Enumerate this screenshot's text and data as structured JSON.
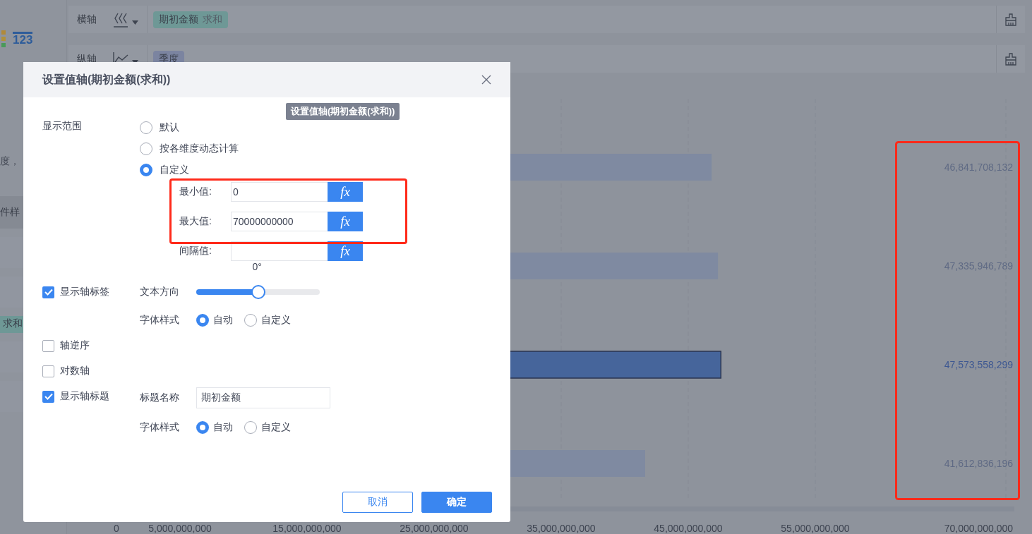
{
  "left_panel": {
    "icon_label": "123",
    "texts": [
      "度，",
      "件样"
    ],
    "tag": "求和"
  },
  "axis_rows": [
    {
      "label": "横轴",
      "tags": [
        {
          "text": "期初金额",
          "aggregation": "求和",
          "color": "#6e9896"
        }
      ]
    },
    {
      "label": "纵轴",
      "tags": [
        {
          "text": "季度",
          "color": "#7b84a0"
        }
      ]
    }
  ],
  "chart": {
    "bar_states": [
      {
        "selected": false
      },
      {
        "selected": false
      },
      {
        "selected": true
      },
      {
        "selected": false
      }
    ],
    "tick_labels": [
      "0",
      "5,000,000,000",
      "15,000,000,000",
      "25,000,000,000",
      "35,000,000,000",
      "45,000,000,000",
      "55,000,000,000",
      "70,000,000,000"
    ],
    "value_labels": [
      "46,841,708,132",
      "47,335,946,789",
      "47,573,558,299",
      "41,612,836,196"
    ]
  },
  "dialog": {
    "title": "设置值轴(期初金额(求和))",
    "tooltip": "设置值轴(期初金额(求和))",
    "range": {
      "label": "显示范围",
      "options": [
        {
          "label": "默认",
          "selected": false
        },
        {
          "label": "按各维度动态计算",
          "selected": false
        },
        {
          "label": "自定义",
          "selected": true
        }
      ],
      "fields": [
        {
          "label": "最小值:",
          "value": "0",
          "button": "fx"
        },
        {
          "label": "最大值:",
          "value": "70000000000",
          "button": "fx"
        },
        {
          "label": "间隔值:",
          "button": "fx"
        }
      ]
    },
    "options": [
      {
        "kind": "slider",
        "label": "显示轴标签",
        "checked": true,
        "setting_label": "文本方向",
        "reading": "0°",
        "level": 0.5,
        "font_label": "字体样式",
        "font_options": [
          {
            "label": "自动",
            "selected": true
          },
          {
            "label": "自定义",
            "selected": false
          }
        ]
      },
      {
        "kind": "plain",
        "label": "轴逆序",
        "checked": false
      },
      {
        "kind": "plain",
        "label": "对数轴",
        "checked": false
      },
      {
        "kind": "title",
        "label": "显示轴标题",
        "checked": true,
        "setting_label": "标题名称",
        "value": "期初金额",
        "font_label": "字体样式",
        "font_options": [
          {
            "label": "自动",
            "selected": true
          },
          {
            "label": "自定义",
            "selected": false
          }
        ]
      }
    ],
    "buttons": [
      {
        "label": "取消",
        "kind": "secondary"
      },
      {
        "label": "确定",
        "kind": "primary"
      }
    ]
  }
}
